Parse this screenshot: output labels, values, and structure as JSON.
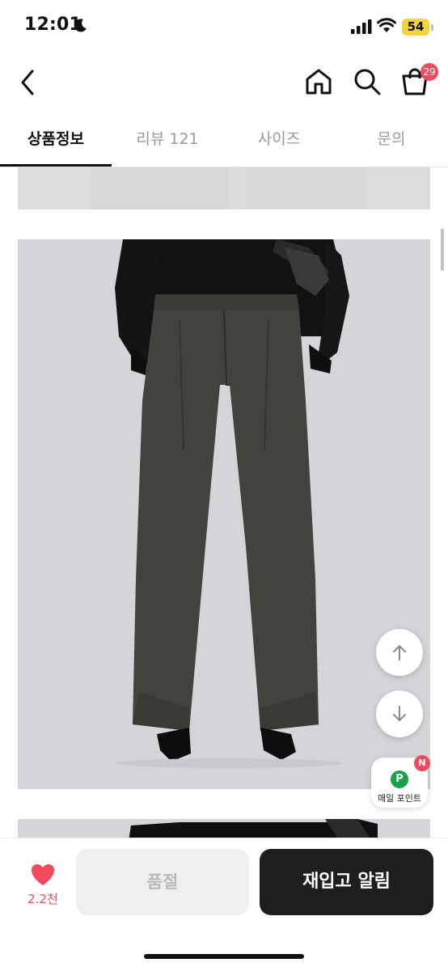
{
  "status_bar": {
    "time": "12:01",
    "battery": "54"
  },
  "nav": {
    "cart_count": "29"
  },
  "tabs": [
    {
      "label": "상품정보"
    },
    {
      "label": "리뷰 121"
    },
    {
      "label": "사이즈"
    },
    {
      "label": "문의"
    }
  ],
  "points_widget": {
    "icon_letter": "P",
    "label": "매일 포인트",
    "badge": "N"
  },
  "bottom_bar": {
    "likes": "2.2천",
    "soldout_label": "품절",
    "restock_label": "재입고 알림"
  },
  "colors": {
    "accent": "#f04a5c",
    "dark_button": "#1e1e1e",
    "points_green": "#19a24a"
  }
}
